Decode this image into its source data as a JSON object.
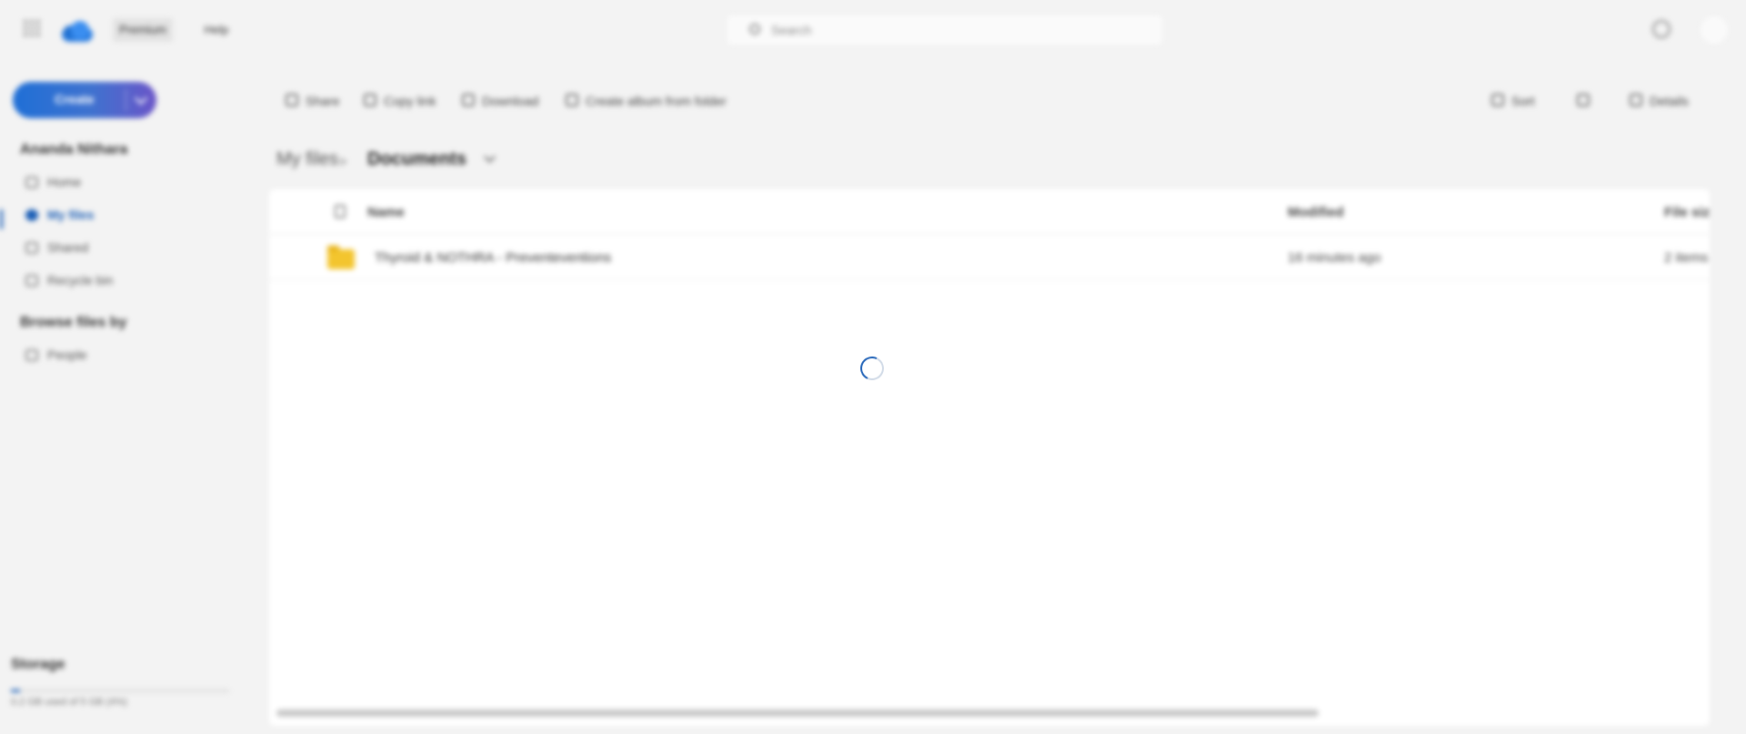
{
  "topbar": {
    "premium_label": "Premium",
    "help_label": "Help",
    "search_placeholder": "Search"
  },
  "sidebar": {
    "create_label": "Create",
    "sections": [
      {
        "heading": "Ananda Nithara",
        "items": [
          {
            "label": "Home"
          },
          {
            "label": "My files"
          },
          {
            "label": "Shared"
          },
          {
            "label": "Recycle bin"
          }
        ]
      },
      {
        "heading": "Browse files by",
        "items": [
          {
            "label": "People"
          }
        ]
      }
    ],
    "storage": {
      "title": "Storage",
      "text": "0.2 GB used of 5 GB (4%)",
      "fraction": 0.04
    }
  },
  "commands": {
    "share": "Share",
    "copy_link": "Copy link",
    "download": "Download",
    "create_album": "Create album from folder",
    "sort": "Sort",
    "view": "",
    "details": "Details"
  },
  "breadcrumb": {
    "root": "My files",
    "separator": ">",
    "current": "Documents"
  },
  "table": {
    "columns": {
      "name": "Name",
      "modified": "Modified",
      "file_size": "File size"
    },
    "rows": [
      {
        "name": "Thyroid & NOTHRA - Preventeventions",
        "modified": "16 minutes ago",
        "file_size": "2 items"
      }
    ]
  },
  "status": {
    "loading": true
  },
  "colors": {
    "accent": "#1c5fb6",
    "folder": "#f3c52e",
    "create_gradient_start": "#1f6fd6",
    "create_gradient_end": "#6a55c8"
  }
}
